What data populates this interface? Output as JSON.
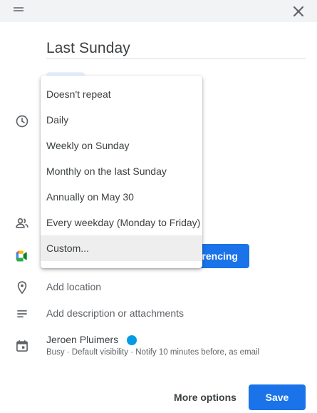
{
  "event": {
    "title": "Last Sunday"
  },
  "recurrence_menu": {
    "options": [
      "Doesn't repeat",
      "Daily",
      "Weekly on Sunday",
      "Monthly on the last Sunday",
      "Annually on May 30",
      "Every weekday (Monday to Friday)",
      "Custom..."
    ],
    "highlighted": "Custom..."
  },
  "conference": {
    "button_label_visible": "rencing"
  },
  "location": {
    "placeholder": "Add location"
  },
  "description": {
    "placeholder": "Add description or attachments"
  },
  "calendar": {
    "owner": "Jeroen Pluimers",
    "color": "#039be5",
    "details": "Busy · Default visibility · Notify 10 minutes before, as email"
  },
  "footer": {
    "more_options_label": "More options",
    "save_label": "Save"
  },
  "theme": {
    "accent": "#1a73e8",
    "topbar_bg": "#f1f3f4"
  }
}
